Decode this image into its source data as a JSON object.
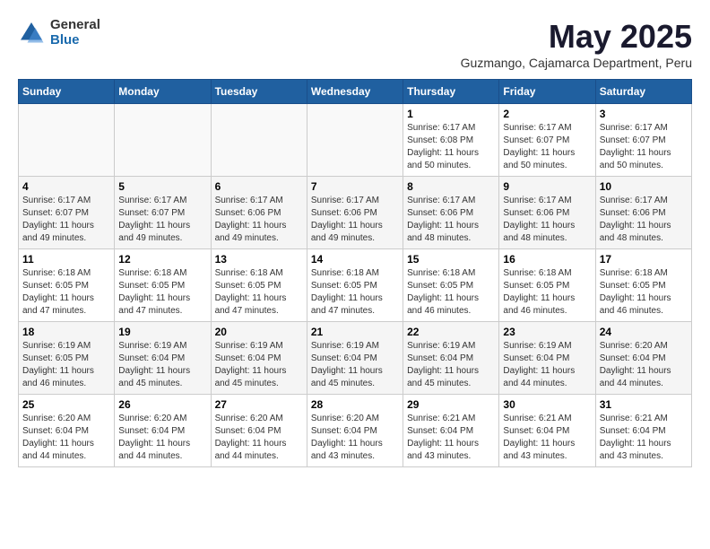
{
  "logo": {
    "general": "General",
    "blue": "Blue"
  },
  "title": "May 2025",
  "subtitle": "Guzmango, Cajamarca Department, Peru",
  "days_of_week": [
    "Sunday",
    "Monday",
    "Tuesday",
    "Wednesday",
    "Thursday",
    "Friday",
    "Saturday"
  ],
  "weeks": [
    [
      {
        "day": "",
        "info": ""
      },
      {
        "day": "",
        "info": ""
      },
      {
        "day": "",
        "info": ""
      },
      {
        "day": "",
        "info": ""
      },
      {
        "day": "1",
        "info": "Sunrise: 6:17 AM\nSunset: 6:08 PM\nDaylight: 11 hours\nand 50 minutes."
      },
      {
        "day": "2",
        "info": "Sunrise: 6:17 AM\nSunset: 6:07 PM\nDaylight: 11 hours\nand 50 minutes."
      },
      {
        "day": "3",
        "info": "Sunrise: 6:17 AM\nSunset: 6:07 PM\nDaylight: 11 hours\nand 50 minutes."
      }
    ],
    [
      {
        "day": "4",
        "info": "Sunrise: 6:17 AM\nSunset: 6:07 PM\nDaylight: 11 hours\nand 49 minutes."
      },
      {
        "day": "5",
        "info": "Sunrise: 6:17 AM\nSunset: 6:07 PM\nDaylight: 11 hours\nand 49 minutes."
      },
      {
        "day": "6",
        "info": "Sunrise: 6:17 AM\nSunset: 6:06 PM\nDaylight: 11 hours\nand 49 minutes."
      },
      {
        "day": "7",
        "info": "Sunrise: 6:17 AM\nSunset: 6:06 PM\nDaylight: 11 hours\nand 49 minutes."
      },
      {
        "day": "8",
        "info": "Sunrise: 6:17 AM\nSunset: 6:06 PM\nDaylight: 11 hours\nand 48 minutes."
      },
      {
        "day": "9",
        "info": "Sunrise: 6:17 AM\nSunset: 6:06 PM\nDaylight: 11 hours\nand 48 minutes."
      },
      {
        "day": "10",
        "info": "Sunrise: 6:17 AM\nSunset: 6:06 PM\nDaylight: 11 hours\nand 48 minutes."
      }
    ],
    [
      {
        "day": "11",
        "info": "Sunrise: 6:18 AM\nSunset: 6:05 PM\nDaylight: 11 hours\nand 47 minutes."
      },
      {
        "day": "12",
        "info": "Sunrise: 6:18 AM\nSunset: 6:05 PM\nDaylight: 11 hours\nand 47 minutes."
      },
      {
        "day": "13",
        "info": "Sunrise: 6:18 AM\nSunset: 6:05 PM\nDaylight: 11 hours\nand 47 minutes."
      },
      {
        "day": "14",
        "info": "Sunrise: 6:18 AM\nSunset: 6:05 PM\nDaylight: 11 hours\nand 47 minutes."
      },
      {
        "day": "15",
        "info": "Sunrise: 6:18 AM\nSunset: 6:05 PM\nDaylight: 11 hours\nand 46 minutes."
      },
      {
        "day": "16",
        "info": "Sunrise: 6:18 AM\nSunset: 6:05 PM\nDaylight: 11 hours\nand 46 minutes."
      },
      {
        "day": "17",
        "info": "Sunrise: 6:18 AM\nSunset: 6:05 PM\nDaylight: 11 hours\nand 46 minutes."
      }
    ],
    [
      {
        "day": "18",
        "info": "Sunrise: 6:19 AM\nSunset: 6:05 PM\nDaylight: 11 hours\nand 46 minutes."
      },
      {
        "day": "19",
        "info": "Sunrise: 6:19 AM\nSunset: 6:04 PM\nDaylight: 11 hours\nand 45 minutes."
      },
      {
        "day": "20",
        "info": "Sunrise: 6:19 AM\nSunset: 6:04 PM\nDaylight: 11 hours\nand 45 minutes."
      },
      {
        "day": "21",
        "info": "Sunrise: 6:19 AM\nSunset: 6:04 PM\nDaylight: 11 hours\nand 45 minutes."
      },
      {
        "day": "22",
        "info": "Sunrise: 6:19 AM\nSunset: 6:04 PM\nDaylight: 11 hours\nand 45 minutes."
      },
      {
        "day": "23",
        "info": "Sunrise: 6:19 AM\nSunset: 6:04 PM\nDaylight: 11 hours\nand 44 minutes."
      },
      {
        "day": "24",
        "info": "Sunrise: 6:20 AM\nSunset: 6:04 PM\nDaylight: 11 hours\nand 44 minutes."
      }
    ],
    [
      {
        "day": "25",
        "info": "Sunrise: 6:20 AM\nSunset: 6:04 PM\nDaylight: 11 hours\nand 44 minutes."
      },
      {
        "day": "26",
        "info": "Sunrise: 6:20 AM\nSunset: 6:04 PM\nDaylight: 11 hours\nand 44 minutes."
      },
      {
        "day": "27",
        "info": "Sunrise: 6:20 AM\nSunset: 6:04 PM\nDaylight: 11 hours\nand 44 minutes."
      },
      {
        "day": "28",
        "info": "Sunrise: 6:20 AM\nSunset: 6:04 PM\nDaylight: 11 hours\nand 43 minutes."
      },
      {
        "day": "29",
        "info": "Sunrise: 6:21 AM\nSunset: 6:04 PM\nDaylight: 11 hours\nand 43 minutes."
      },
      {
        "day": "30",
        "info": "Sunrise: 6:21 AM\nSunset: 6:04 PM\nDaylight: 11 hours\nand 43 minutes."
      },
      {
        "day": "31",
        "info": "Sunrise: 6:21 AM\nSunset: 6:04 PM\nDaylight: 11 hours\nand 43 minutes."
      }
    ]
  ]
}
